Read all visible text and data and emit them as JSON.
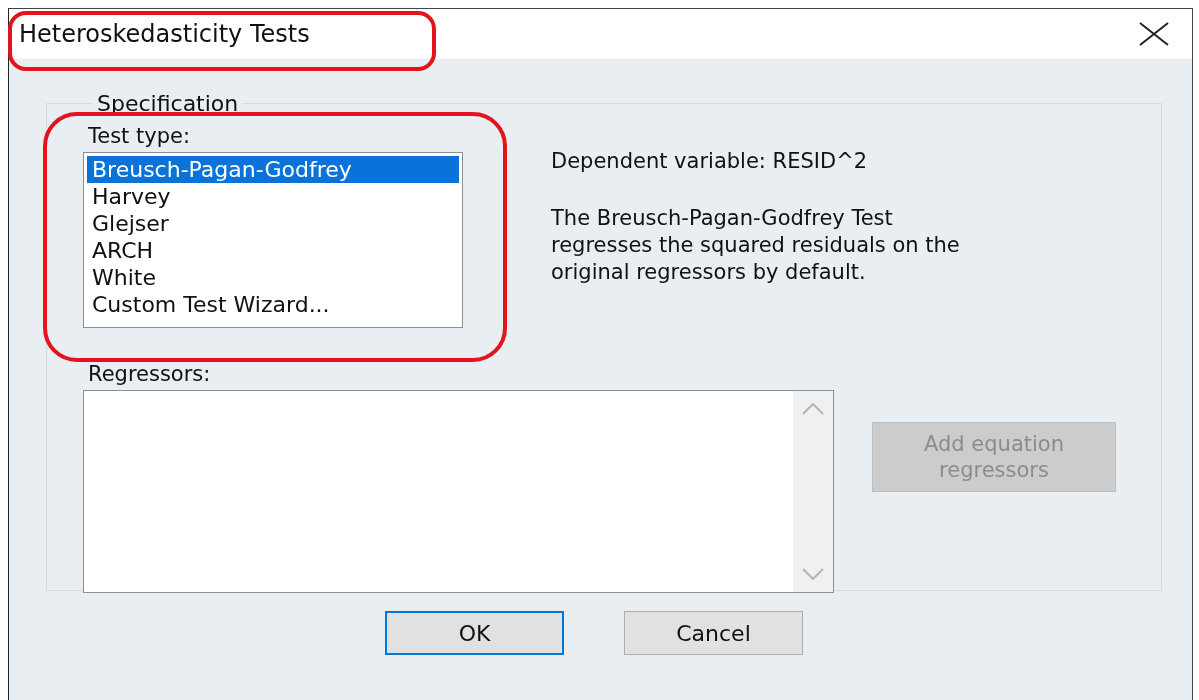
{
  "window": {
    "title": "Heteroskedasticity Tests"
  },
  "specification": {
    "label": "Specification",
    "test_type": {
      "label": "Test type:",
      "options": [
        {
          "label": "Breusch-Pagan-Godfrey",
          "selected": true
        },
        {
          "label": "Harvey",
          "selected": false
        },
        {
          "label": "Glejser",
          "selected": false
        },
        {
          "label": "ARCH",
          "selected": false
        },
        {
          "label": "White",
          "selected": false
        },
        {
          "label": "Custom Test Wizard...",
          "selected": false
        }
      ]
    },
    "dependent_variable": "Dependent variable: RESID^2",
    "description_lines": [
      "The Breusch-Pagan-Godfrey Test",
      "regresses the squared residuals on the",
      "original regressors by default."
    ],
    "regressors": {
      "label": "Regressors:"
    },
    "add_button": {
      "label": "Add equation regressors",
      "disabled": true
    }
  },
  "buttons": [
    {
      "label": "OK",
      "default": true
    },
    {
      "label": "Cancel",
      "default": false
    }
  ]
}
